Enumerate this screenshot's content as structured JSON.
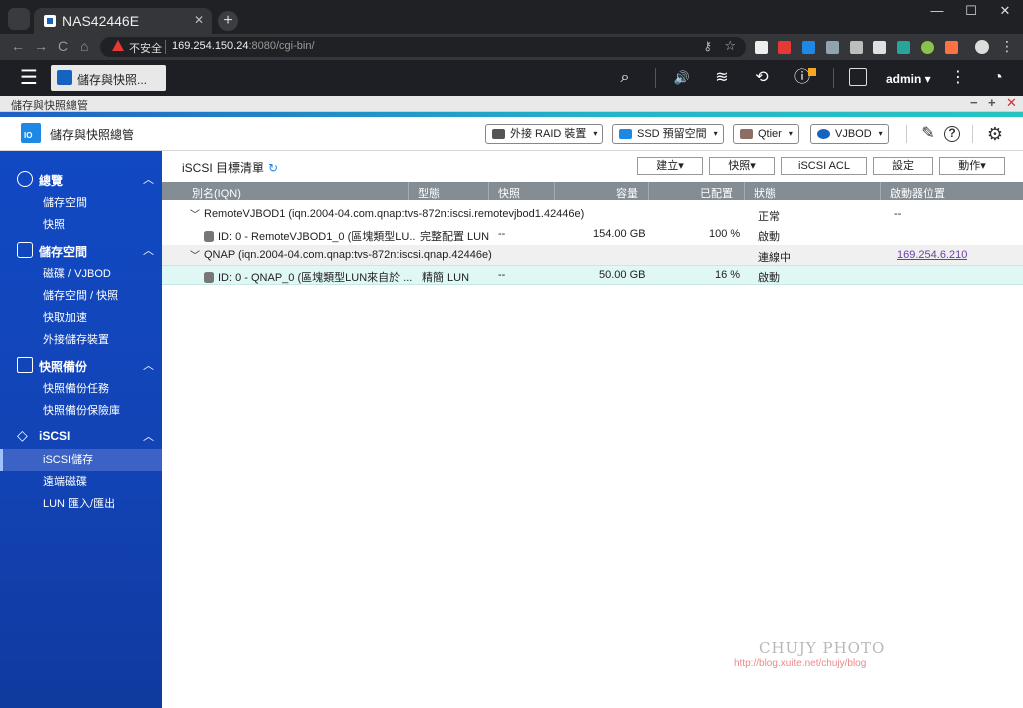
{
  "browser": {
    "tab_title": "NAS42446E",
    "tab_close": "✕",
    "new_tab": "+",
    "insecure_label": "不安全",
    "url_host": "169.254.150.24",
    "url_rest": ":8080/cgi-bin/",
    "min": "—",
    "max": "☐",
    "close": "✕",
    "back": "←",
    "forward": "→",
    "reload": "C",
    "home": "⌂",
    "key": "⚷",
    "star": "☆",
    "menu": "⋮"
  },
  "topbar": {
    "menu": "☰",
    "app_tab_label": "儲存與快照...",
    "search": "⌕",
    "volume": "🔊",
    "tasks": "≋",
    "sync": "⟲",
    "info": "ⓘ",
    "username": "admin ▾",
    "more": "⋮",
    "dashboard": "◔"
  },
  "window": {
    "title": "儲存與快照總管",
    "minimize": "−",
    "maximize": "+",
    "close": "✕"
  },
  "header": {
    "title": "儲存與快照總管",
    "buttons": [
      "外接 RAID 裝置",
      "SSD 預留空間",
      "Qtier",
      "VJBOD"
    ],
    "caret": "▾",
    "tools": "✎",
    "help": "?",
    "settings": "⚙"
  },
  "sidebar": {
    "chevron": "︿",
    "sections": [
      {
        "label": "總覽",
        "items": [
          "儲存空間",
          "快照"
        ]
      },
      {
        "label": "儲存空間",
        "items": [
          "磁碟 / VJBOD",
          "儲存空間 / 快照",
          "快取加速",
          "外接儲存裝置"
        ]
      },
      {
        "label": "快照備份",
        "items": [
          "快照備份任務",
          "快照備份保險庫"
        ]
      },
      {
        "label": "iSCSI",
        "items": [
          "iSCSI儲存",
          "遠端磁碟",
          "LUN 匯入/匯出"
        ]
      }
    ]
  },
  "main": {
    "title": "iSCSI 目標清單",
    "refresh": "↻",
    "actions": [
      "建立▾",
      "快照▾",
      "iSCSI ACL",
      "設定",
      "動作▾"
    ],
    "columns": [
      "別名(IQN)",
      "型態",
      "快照",
      "容量",
      "已配置",
      "狀態",
      "啟動器位置"
    ],
    "rows": [
      {
        "alias": "RemoteVJBOD1 (iqn.2004-04.com.qnap:tvs-872n:iscsi.remotevjbod1.42446e)",
        "status": "正常",
        "initiator": "--"
      },
      {
        "alias": "ID: 0 - RemoteVJBOD1_0 (區塊類型LU...",
        "type": "完整配置 LUN",
        "snapshot": "--",
        "capacity": "154.00 GB",
        "allocated": "100 %",
        "status": "啟動"
      },
      {
        "alias": "QNAP (iqn.2004-04.com.qnap:tvs-872n:iscsi.qnap.42446e)",
        "status": "連線中",
        "initiator": "169.254.6.210"
      },
      {
        "alias": "ID: 0 - QNAP_0 (區塊類型LUN來自於 ...",
        "type": "精簡 LUN",
        "snapshot": "--",
        "capacity": "50.00 GB",
        "allocated": "16 %",
        "status": "啟動"
      }
    ],
    "expand": "﹀"
  },
  "watermark": {
    "line1": "CHUJY PHOTO",
    "line2": "http://blog.xuite.net/chujy/blog"
  }
}
